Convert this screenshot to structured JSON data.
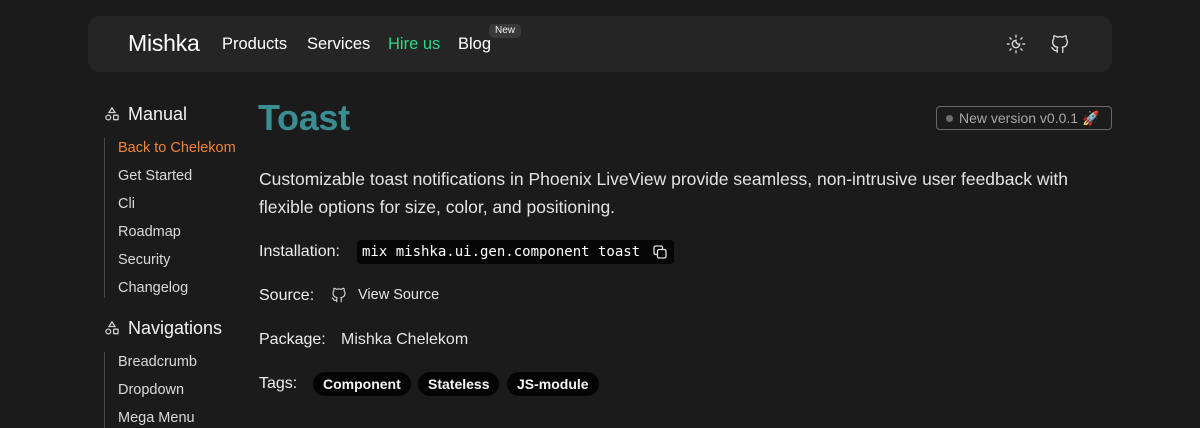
{
  "navbar": {
    "brand": "Mishka",
    "links": [
      {
        "label": "Products"
      },
      {
        "label": "Services"
      },
      {
        "label": "Hire us"
      },
      {
        "label": "Blog"
      }
    ],
    "blog_badge": "New",
    "accent_color": "#2bd985",
    "icons": [
      "theme-toggle-icon",
      "github-icon"
    ]
  },
  "sidebar": {
    "sections": [
      {
        "title": "Manual",
        "items": [
          "Back to Chelekom",
          "Get Started",
          "Cli",
          "Roadmap",
          "Security",
          "Changelog"
        ]
      },
      {
        "title": "Navigations",
        "items": [
          "Breadcrumb",
          "Dropdown",
          "Mega Menu"
        ]
      }
    ],
    "active_item": "Back to Chelekom",
    "active_color": "#f0843a"
  },
  "main": {
    "title": "Toast",
    "title_color": "#3a8e93",
    "version_label": "New version v0.0.1 🚀",
    "description": "Customizable toast notifications in Phoenix LiveView provide seamless, non-intrusive user feedback with flexible options for size, color, and positioning.",
    "installation": {
      "label": "Installation:",
      "command": "mix mishka.ui.gen.component toast"
    },
    "source": {
      "label": "Source:",
      "link_text": "View Source"
    },
    "package": {
      "label": "Package:",
      "value": "Mishka Chelekom"
    },
    "tags": {
      "label": "Tags:",
      "items": [
        "Component",
        "Stateless",
        "JS-module"
      ]
    }
  }
}
